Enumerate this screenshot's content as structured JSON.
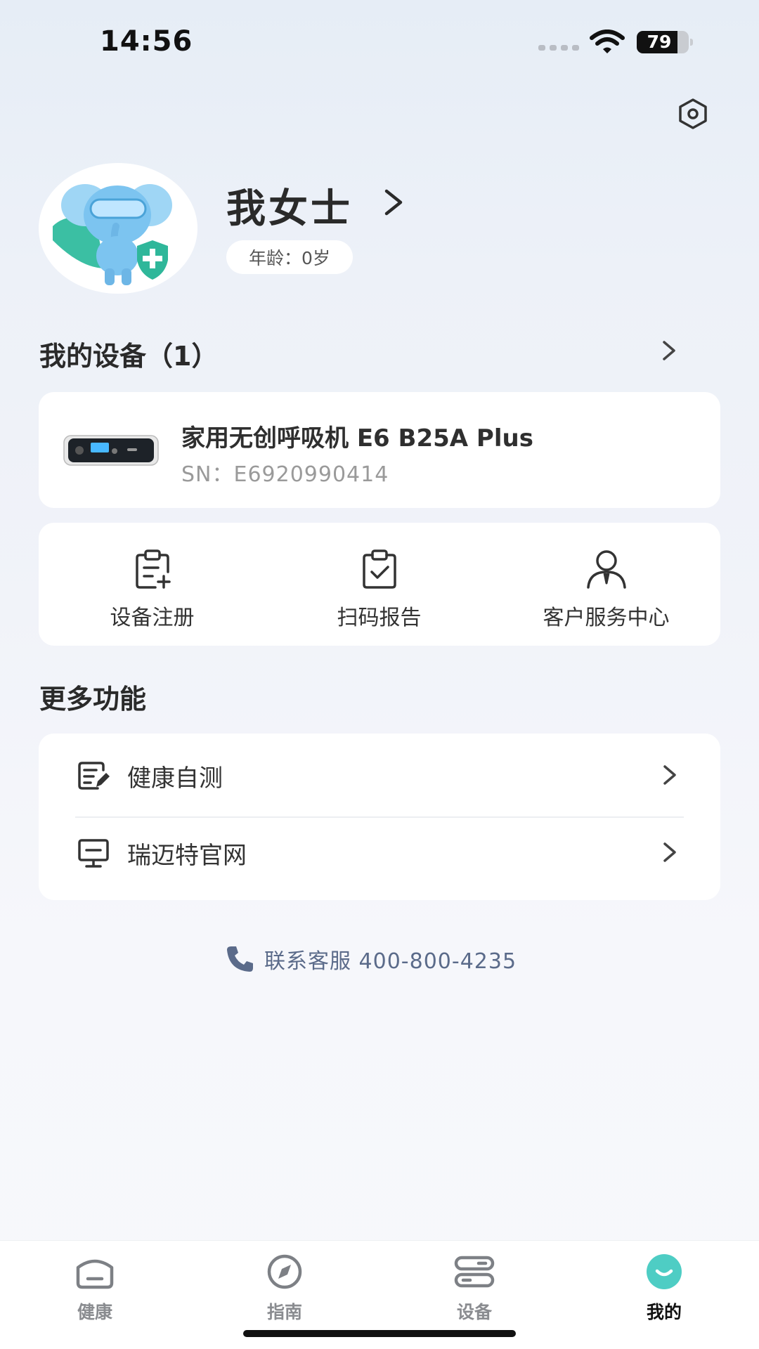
{
  "status_bar": {
    "time": "14:56",
    "battery": "79",
    "battery_level": 0.79
  },
  "profile": {
    "name": "我女士",
    "age_label": "年龄：0岁"
  },
  "devices": {
    "title": "我的设备（1）",
    "items": [
      {
        "name": "家用无创呼吸机 E6 B25A Plus",
        "sn": "SN：E6920990414"
      }
    ]
  },
  "actions": [
    {
      "label": "设备注册",
      "icon": "clipboard-plus-icon"
    },
    {
      "label": "扫码报告",
      "icon": "clipboard-check-icon"
    },
    {
      "label": "客户服务中心",
      "icon": "customer-service-icon"
    }
  ],
  "more": {
    "title": "更多功能",
    "items": [
      {
        "label": "健康自测",
        "icon": "edit-document-icon"
      },
      {
        "label": "瑞迈特官网",
        "icon": "monitor-icon"
      }
    ]
  },
  "contact": {
    "text": "联系客服 400-800-4235",
    "icon": "phone-icon"
  },
  "tabs": [
    {
      "label": "健康",
      "icon": "health-icon",
      "active": false
    },
    {
      "label": "指南",
      "icon": "compass-icon",
      "active": false
    },
    {
      "label": "设备",
      "icon": "device-icon",
      "active": false
    },
    {
      "label": "我的",
      "icon": "smile-icon",
      "active": true
    }
  ],
  "colors": {
    "accent": "#4ecdc4",
    "contact_text": "#5b6b8a",
    "tab_inactive": "#8a8c90"
  }
}
